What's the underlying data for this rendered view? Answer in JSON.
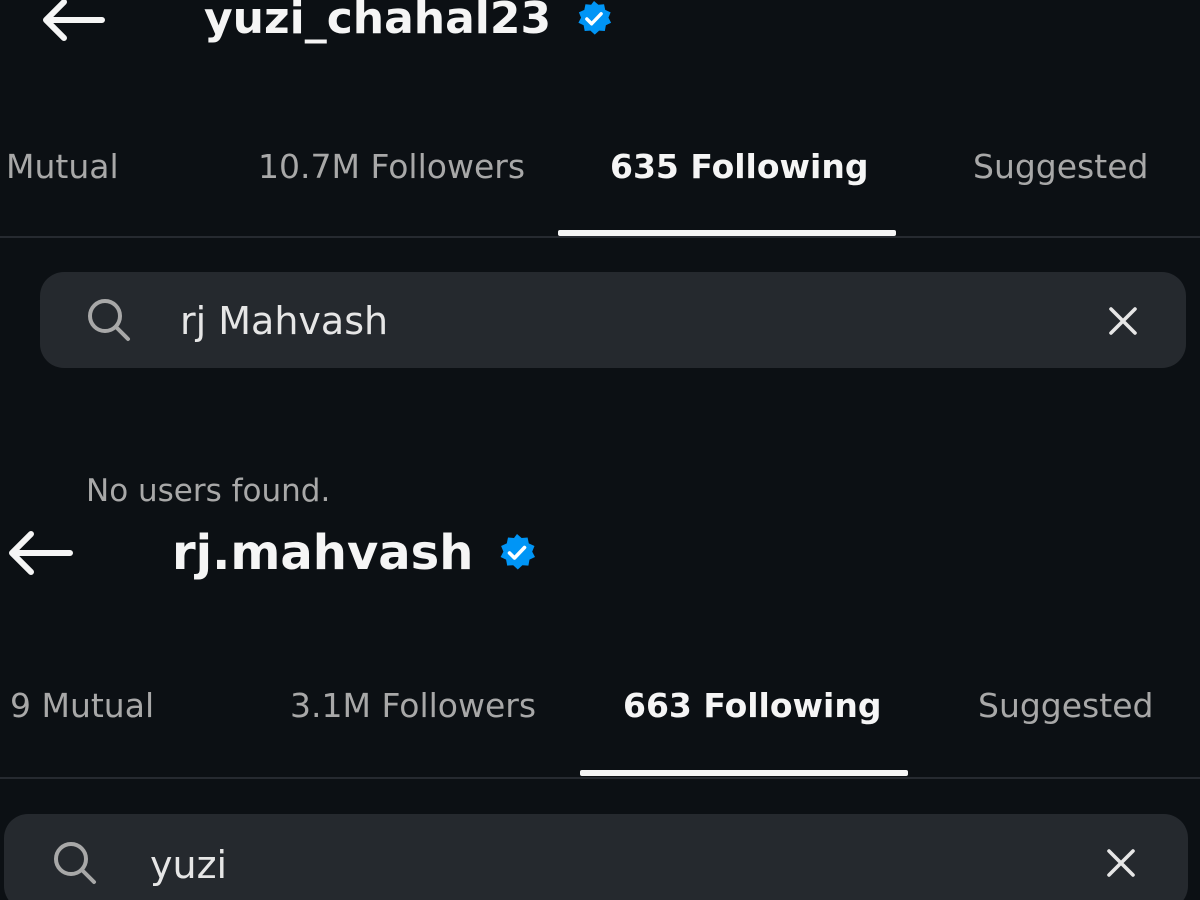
{
  "profile_1": {
    "username": "yuzi_chahal23",
    "verified": true,
    "tabs": [
      {
        "label": "Mutual",
        "active": false
      },
      {
        "label": "10.7M Followers",
        "active": false
      },
      {
        "label": "635 Following",
        "active": true
      },
      {
        "label": "Suggested",
        "active": false
      }
    ],
    "search": {
      "value": "rj Mahvash"
    },
    "empty_message": "No users found."
  },
  "profile_2": {
    "username": "rj.mahvash",
    "verified": true,
    "tabs": [
      {
        "label": "9 Mutual",
        "active": false
      },
      {
        "label": "3.1M Followers",
        "active": false
      },
      {
        "label": "663 Following",
        "active": true
      },
      {
        "label": "Suggested",
        "active": false
      }
    ],
    "search": {
      "value": "yuzi"
    }
  },
  "colors": {
    "background": "#0c1014",
    "search_bg": "#25292e",
    "verified_blue": "#0095f6",
    "active_text": "#f5f5f5",
    "inactive_text": "#a8a8a8"
  },
  "icons": {
    "back": "arrow-left-icon",
    "verified": "verified-badge-icon",
    "search": "search-icon",
    "clear": "close-icon"
  }
}
